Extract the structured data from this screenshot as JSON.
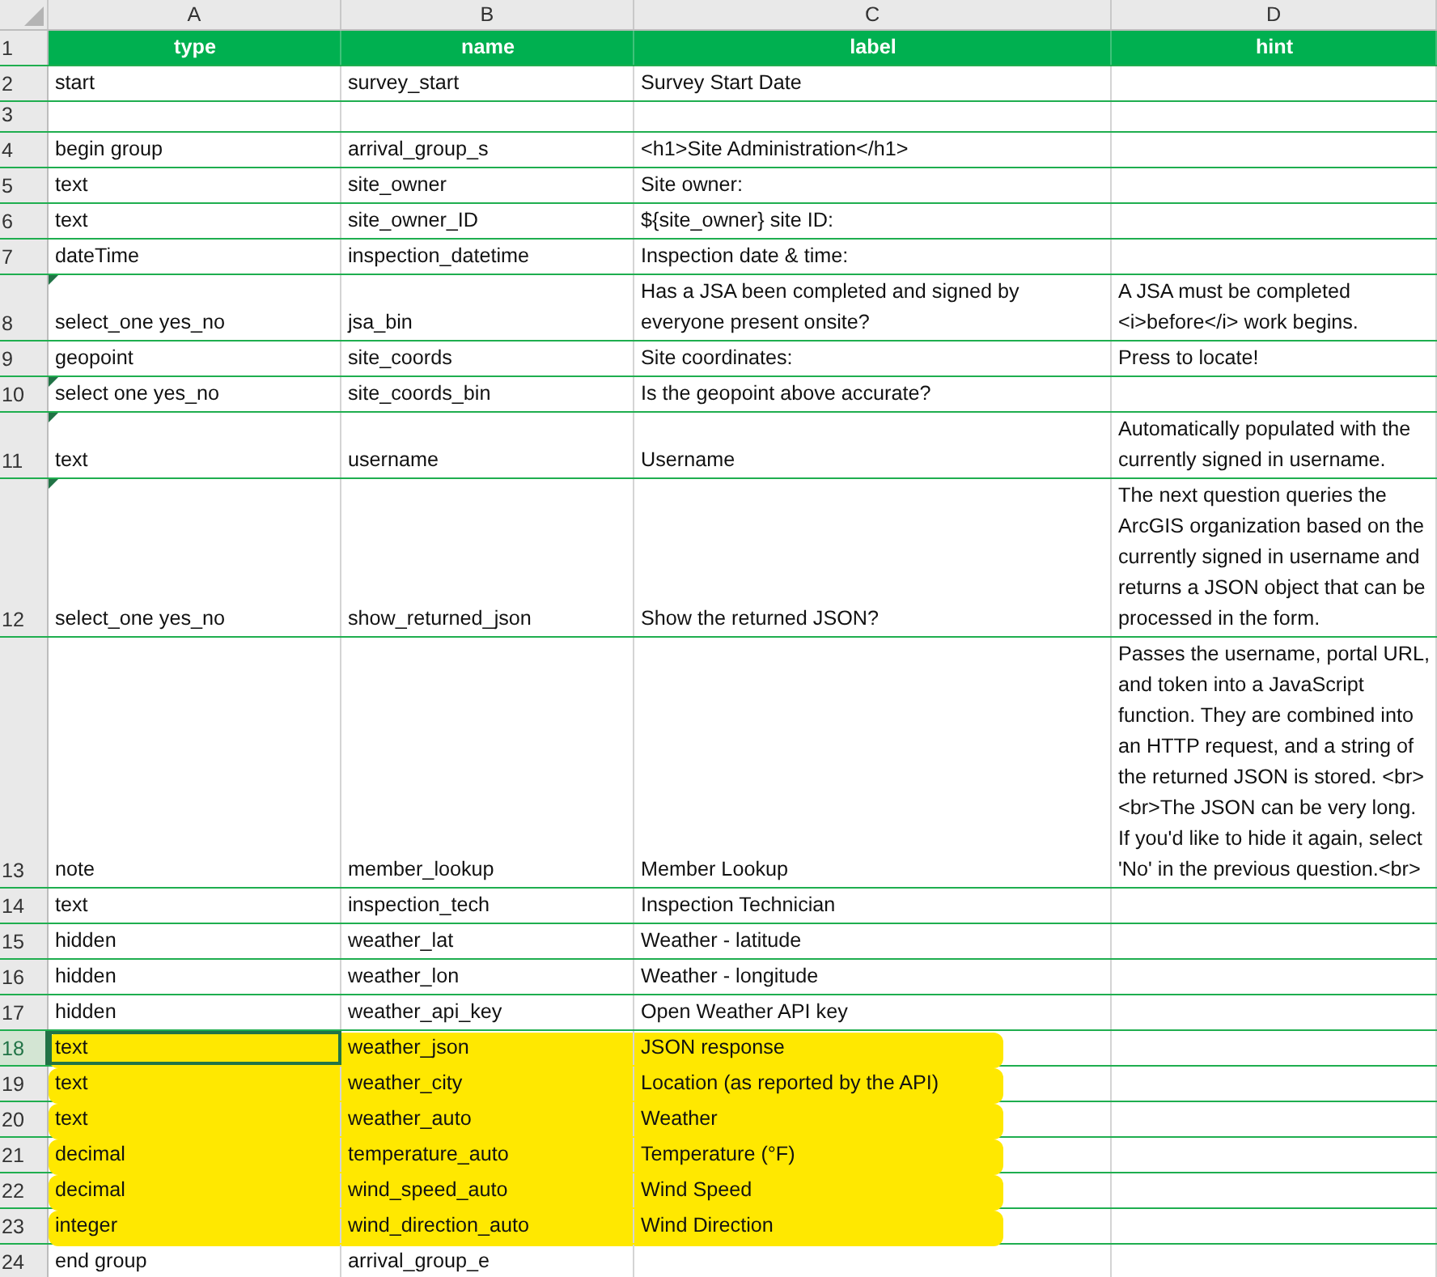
{
  "column_headers": [
    "A",
    "B",
    "C",
    "D"
  ],
  "header_row": {
    "number": "1",
    "cells": [
      "type",
      "name",
      "label",
      "hint"
    ]
  },
  "rows": [
    {
      "number": "2",
      "type": "start",
      "name": "survey_start",
      "label": "Survey Start Date",
      "comment": false,
      "highlighted": false,
      "selected": false
    },
    {
      "number": "3",
      "comment": false,
      "highlighted": false,
      "selected": false
    },
    {
      "number": "4",
      "type": "begin group",
      "name": "arrival_group_s",
      "label": "<h1>Site Administration</h1>",
      "comment": false,
      "highlighted": false,
      "selected": false
    },
    {
      "number": "5",
      "type": "text",
      "name": "site_owner",
      "label": "Site owner:",
      "comment": false,
      "highlighted": false,
      "selected": false
    },
    {
      "number": "6",
      "type": "text",
      "name": "site_owner_ID",
      "label": "${site_owner} site ID:",
      "comment": false,
      "highlighted": false,
      "selected": false
    },
    {
      "number": "7",
      "type": "dateTime",
      "name": "inspection_datetime",
      "label": "Inspection date & time:",
      "comment": false,
      "highlighted": false,
      "selected": false
    },
    {
      "number": "8",
      "type": "select_one yes_no",
      "name": "jsa_bin",
      "label": "Has a JSA been completed and signed by everyone present onsite?",
      "hint": "A JSA must be completed <i>before</i> work begins.",
      "comment": true,
      "highlighted": false,
      "selected": false
    },
    {
      "number": "9",
      "type": "geopoint",
      "name": "site_coords",
      "label": "Site coordinates:",
      "hint": "Press to locate!",
      "comment": false,
      "highlighted": false,
      "selected": false
    },
    {
      "number": "10",
      "type": "select one yes_no",
      "name": "site_coords_bin",
      "label": "Is the geopoint above accurate?",
      "comment": true,
      "highlighted": false,
      "selected": false
    },
    {
      "number": "11",
      "type": "text",
      "name": "username",
      "label": "Username",
      "hint": "Automatically populated with the currently signed in username.",
      "comment": true,
      "highlighted": false,
      "selected": false
    },
    {
      "number": "12",
      "type": "select_one yes_no",
      "name": "show_returned_json",
      "label": "Show the returned JSON?",
      "hint": "The next question queries the ArcGIS organization based on the currently signed in username and returns a JSON object that can be processed in the form.",
      "comment": true,
      "highlighted": false,
      "selected": false
    },
    {
      "number": "13",
      "type": "note",
      "name": "member_lookup",
      "label": "Member Lookup",
      "hint": "Passes the username, portal URL, and token into a JavaScript function. They are combined into an HTTP request, and a string of the returned JSON is stored. <br><br>The JSON can be very long. If you'd like to hide it again, select 'No' in the previous question.<br>",
      "comment": false,
      "highlighted": false,
      "selected": false
    },
    {
      "number": "14",
      "type": "text",
      "name": "inspection_tech",
      "label": "Inspection Technician",
      "comment": false,
      "highlighted": false,
      "selected": false
    },
    {
      "number": "15",
      "type": "hidden",
      "name": "weather_lat",
      "label": "Weather - latitude",
      "comment": false,
      "highlighted": false,
      "selected": false
    },
    {
      "number": "16",
      "type": "hidden",
      "name": "weather_lon",
      "label": "Weather - longitude",
      "comment": false,
      "highlighted": false,
      "selected": false
    },
    {
      "number": "17",
      "type": "hidden",
      "name": "weather_api_key",
      "label": "Open Weather API key",
      "comment": false,
      "highlighted": false,
      "selected": false
    },
    {
      "number": "18",
      "type": "text",
      "name": "weather_json",
      "label": "JSON response",
      "comment": false,
      "highlighted": true,
      "selected": true
    },
    {
      "number": "19",
      "type": "text",
      "name": "weather_city",
      "label": "Location (as reported by the API)",
      "comment": false,
      "highlighted": true,
      "selected": false
    },
    {
      "number": "20",
      "type": "text",
      "name": "weather_auto",
      "label": "Weather",
      "comment": false,
      "highlighted": true,
      "selected": false
    },
    {
      "number": "21",
      "type": "decimal",
      "name": "temperature_auto",
      "label": "Temperature (°F)",
      "comment": false,
      "highlighted": true,
      "selected": false
    },
    {
      "number": "22",
      "type": "decimal",
      "name": "wind_speed_auto",
      "label": "Wind Speed",
      "comment": false,
      "highlighted": true,
      "selected": false
    },
    {
      "number": "23",
      "type": "integer",
      "name": "wind_direction_auto",
      "label": "Wind Direction",
      "comment": false,
      "highlighted": true,
      "selected": false
    },
    {
      "number": "24",
      "type": "end group",
      "name": "arrival_group_e",
      "comment": false,
      "highlighted": false,
      "selected": false
    }
  ]
}
